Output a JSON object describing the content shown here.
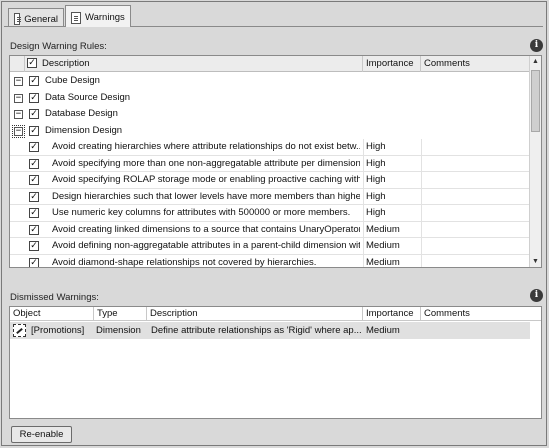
{
  "tabs": [
    {
      "label": "General",
      "icon": "general-tab-icon"
    },
    {
      "label": "Warnings",
      "icon": "warnings-tab-icon"
    }
  ],
  "design_warning_rules": {
    "label": "Design Warning Rules:",
    "columns": {
      "description": "Description",
      "importance": "Importance",
      "comments": "Comments"
    },
    "groups": [
      {
        "name": "Cube Design",
        "expander": "−",
        "checked": true
      },
      {
        "name": "Data Source Design",
        "expander": "−",
        "checked": true
      },
      {
        "name": "Database Design",
        "expander": "−",
        "checked": true
      },
      {
        "name": "Dimension Design",
        "expander": "−",
        "checked": true
      }
    ],
    "rules": [
      {
        "description": "Avoid creating hierarchies where attribute relationships do not exist betw...",
        "importance": "High",
        "comments": "",
        "checked": true
      },
      {
        "description": "Avoid specifying more than one non-aggregatable attribute per dimension.",
        "importance": "High",
        "comments": "",
        "checked": true
      },
      {
        "description": "Avoid specifying ROLAP storage mode or enabling proactive caching with ...",
        "importance": "High",
        "comments": "",
        "checked": true
      },
      {
        "description": "Design hierarchies such that lower levels have more members than higher ...",
        "importance": "High",
        "comments": "",
        "checked": true
      },
      {
        "description": "Use numeric key columns for attributes with 500000 or more members.",
        "importance": "High",
        "comments": "",
        "checked": true
      },
      {
        "description": "Avoid creating linked dimensions to a source that contains UnaryOperator ...",
        "importance": "Medium",
        "comments": "",
        "checked": true
      },
      {
        "description": "Avoid defining non-aggregatable attributes in a parent-child dimension wit...",
        "importance": "Medium",
        "comments": "",
        "checked": true
      },
      {
        "description": "Avoid diamond-shape relationships not covered by hierarchies.",
        "importance": "Medium",
        "comments": "",
        "checked": true
      }
    ]
  },
  "dismissed_warnings": {
    "label": "Dismissed Warnings:",
    "columns": {
      "object": "Object",
      "type": "Type",
      "description": "Description",
      "importance": "Importance",
      "comments": "Comments"
    },
    "rows": [
      {
        "object": "[Promotions]",
        "type": "Dimension",
        "description": "Define attribute relationships as 'Rigid' where ap...",
        "importance": "Medium",
        "comments": ""
      }
    ]
  },
  "reenable_button": "Re-enable"
}
